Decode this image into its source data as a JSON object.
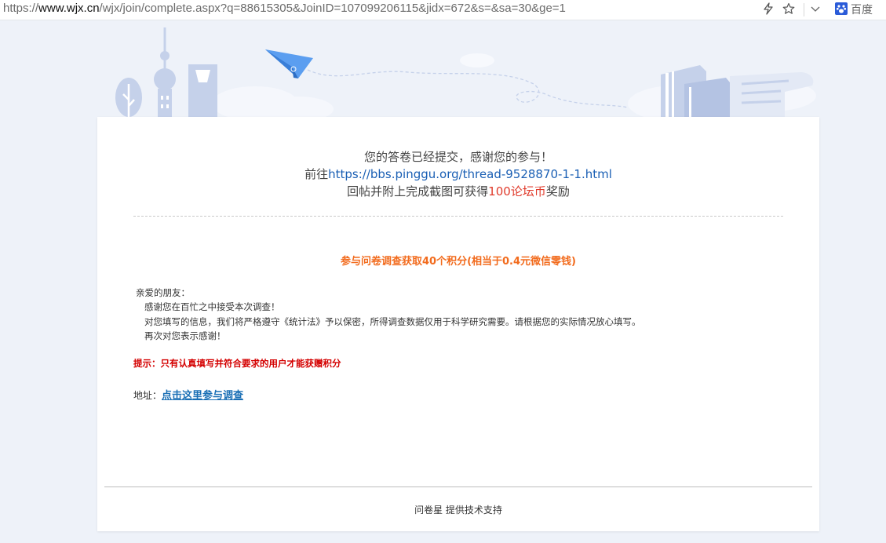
{
  "browser": {
    "url_prefix": "https://",
    "url_host": "www.wjx.cn",
    "url_path": "/wjx/join/complete.aspx?q=88615305&JoinID=107099206115&jidx=672&s=&sa=30&ge=1",
    "search_engine_label": "百度",
    "icons": [
      "lightning-icon",
      "star-icon",
      "chevron-down-icon",
      "baidu-paw-icon"
    ]
  },
  "card": {
    "line1": "您的答卷已经提交，感谢您的参与！",
    "line2_prefix": "前往",
    "line2_link": "https://bbs.pinggu.org/thread-9528870-1-1.html",
    "line3_prefix": "回帖并附上完成截图可获得",
    "line3_highlight": "100论坛币",
    "line3_suffix": "奖励",
    "points_text": "参与问卷调查获取40个积分(相当于0.4元微信零钱)",
    "letter": {
      "greeting": "亲爱的朋友：",
      "p1": "感谢您在百忙之中接受本次调查！",
      "p2": "对您填写的信息，我们将严格遵守《统计法》予以保密，所得调查数据仅用于科学研究需要。请根据您的实际情况放心填写。",
      "p3": "再次对您表示感谢！"
    },
    "tip": "提示：只有认真填写并符合要求的用户才能获赠积分",
    "address_label": "地址：",
    "address_link": "点击这里参与调查",
    "footer": "问卷星 提供技术支持"
  },
  "colors": {
    "page_bg": "#eef2f9",
    "link_blue": "#1a5fb4",
    "highlight_red": "#e03b2c",
    "points_orange": "#f26b1d",
    "tip_red": "#d40000"
  }
}
